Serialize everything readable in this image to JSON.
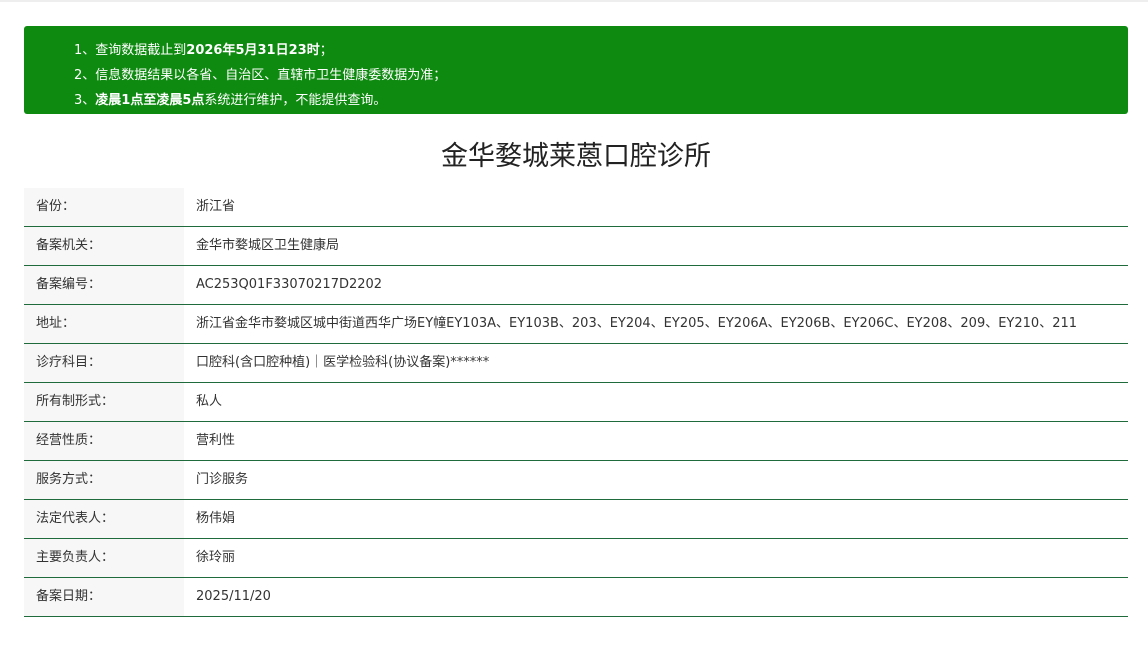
{
  "notice": {
    "line1_prefix": "1、查询数据截止到",
    "line1_bold": "2026年5月31日23时",
    "line1_suffix": "；",
    "line2": "2、信息数据结果以各省、自治区、直辖市卫生健康委数据为准；",
    "line3_prefix": "3、",
    "line3_bold": "凌晨1点至凌晨5点",
    "line3_suffix": "系统进行维护，不能提供查询。"
  },
  "title": "金华婺城莱蒽口腔诊所",
  "rows": [
    {
      "label": "省份：",
      "value": "浙江省"
    },
    {
      "label": "备案机关：",
      "value": "金华市婺城区卫生健康局"
    },
    {
      "label": "备案编号：",
      "value": "AC253Q01F33070217D2202"
    },
    {
      "label": "地址：",
      "value": "浙江省金华市婺城区城中街道西华广场EY幢EY103A、EY103B、203、EY204、EY205、EY206A、EY206B、EY206C、EY208、209、EY210、211"
    },
    {
      "label": "诊疗科目：",
      "value": "口腔科(含口腔种植)｜医学检验科(协议备案)******"
    },
    {
      "label": "所有制形式：",
      "value": "私人"
    },
    {
      "label": "经营性质：",
      "value": "营利性"
    },
    {
      "label": "服务方式：",
      "value": "门诊服务"
    },
    {
      "label": "法定代表人：",
      "value": "杨伟娟"
    },
    {
      "label": "主要负责人：",
      "value": "徐玲丽"
    },
    {
      "label": "备案日期：",
      "value": "2025/11/20"
    }
  ],
  "colors": {
    "notice_bg": "#0e8a10",
    "row_border": "#1f6b3b",
    "label_bg": "#f7f7f7"
  }
}
